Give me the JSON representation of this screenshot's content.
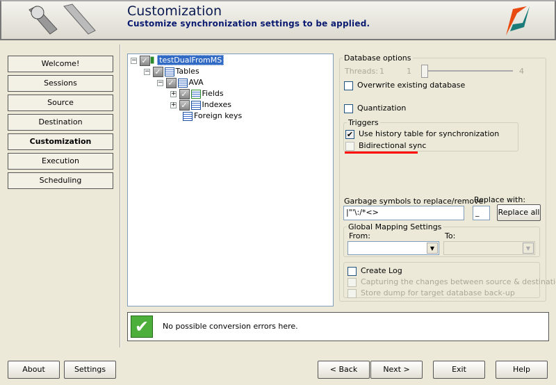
{
  "header": {
    "title": "Customization",
    "subtitle": "Customize synchronization settings to be applied."
  },
  "nav": [
    {
      "label": "Welcome!"
    },
    {
      "label": "Sessions"
    },
    {
      "label": "Source"
    },
    {
      "label": "Destination"
    },
    {
      "label": "Customization",
      "active": true
    },
    {
      "label": "Execution"
    },
    {
      "label": "Scheduling"
    }
  ],
  "tree": {
    "root": "testDualFromMS",
    "tables": "Tables",
    "table": "AVA",
    "fields": "Fields",
    "indexes": "Indexes",
    "foreign_keys": "Foreign keys"
  },
  "db_options": {
    "legend": "Database options",
    "threads_label": "Threads:",
    "threads_min": "1",
    "threads_value": "1",
    "threads_max": "4",
    "overwrite": "Overwrite existing database",
    "overwrite_checked": false,
    "quantization": "Quantization",
    "quantization_checked": false
  },
  "triggers": {
    "legend": "Triggers",
    "history": "Use history table for synchronization",
    "history_checked": true,
    "bidirectional": "Bidirectional sync",
    "bidirectional_checked": false,
    "highlight_color": "#ff0000"
  },
  "garbage": {
    "label": "Garbage symbols to replace/remove",
    "value": "|\"'\\:/*<>",
    "replace_label": "Replace with:",
    "replace_value": "_",
    "replace_all": "Replace all"
  },
  "mapping": {
    "legend": "Global Mapping Settings",
    "from_label": "From:",
    "to_label": "To:",
    "from_value": "",
    "to_value": ""
  },
  "log": {
    "create": "Create Log",
    "capture": "Capturing the changes between source & destinatio",
    "dump": "Store dump for target database back-up"
  },
  "status": {
    "message": "No possible conversion errors here.",
    "icon": "check-icon"
  },
  "footer": {
    "about": "About",
    "settings": "Settings",
    "back": "< Back",
    "next": "Next >",
    "exit": "Exit",
    "help": "Help"
  }
}
